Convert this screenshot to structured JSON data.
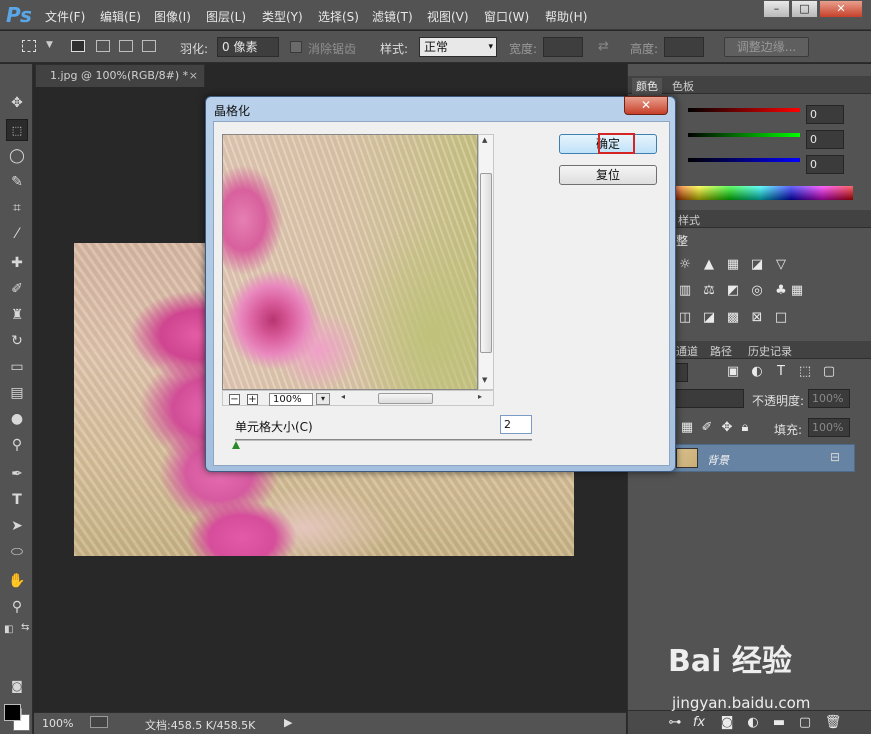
{
  "app": {
    "logo": "Ps"
  },
  "menu": [
    "文件(F)",
    "编辑(E)",
    "图像(I)",
    "图层(L)",
    "类型(Y)",
    "选择(S)",
    "滤镜(T)",
    "视图(V)",
    "窗口(W)",
    "帮助(H)"
  ],
  "window_controls": {
    "minimize": "–",
    "maximize": "□",
    "close": "✕"
  },
  "options": {
    "feather_label": "羽化:",
    "feather_value": "0 像素",
    "antialias_label": "消除锯齿",
    "style_label": "样式:",
    "style_value": "正常",
    "width_label": "宽度:",
    "height_label": "高度:",
    "refine_edge": "调整边缘..."
  },
  "document": {
    "tab_title": "1.jpg @ 100%(RGB/8#) *",
    "tab_close": "×"
  },
  "status": {
    "zoom": "100%",
    "doc_info": "文档:458.5 K/458.5K"
  },
  "panels": {
    "color_tabs": [
      "颜色",
      "色板"
    ],
    "color_values": {
      "r": "0",
      "g": "0",
      "b": "0"
    },
    "adjust_tabs": [
      "样式"
    ],
    "adjust_title": "整",
    "layer_tabs": [
      "通道",
      "路径",
      "历史记录"
    ],
    "opacity_label": "不透明度:",
    "opacity_value": "100%",
    "fill_label": "填充:",
    "fill_value": "100%",
    "layer_name": "背景"
  },
  "dialog": {
    "title": "晶格化",
    "close": "✕",
    "ok": "确定",
    "reset": "复位",
    "zoom": "100%",
    "param_label": "单元格大小(C)",
    "param_value": "2"
  },
  "watermark": {
    "logo": "Bai 经验",
    "url": "jingyan.baidu.com"
  },
  "colors": {
    "accent": "#5aa7e8",
    "highlight": "#d42424",
    "layer_selected": "#6683a3"
  }
}
